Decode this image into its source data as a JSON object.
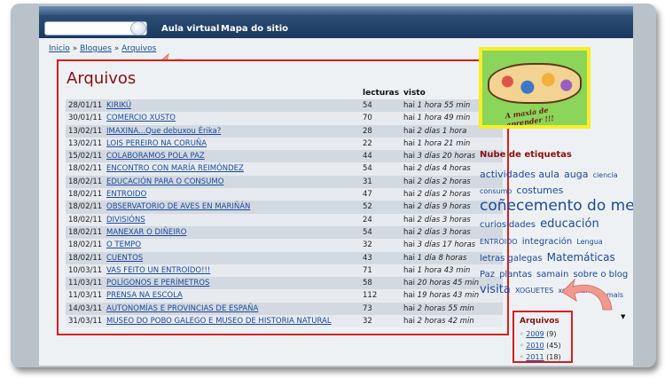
{
  "header": {
    "search": {
      "value": "",
      "placeholder": ""
    },
    "nav": [
      "Aula virtual",
      "Mapa do sitio"
    ]
  },
  "breadcrumb": [
    "Inicio",
    "Blogues",
    "Arquivos"
  ],
  "main": {
    "title": "Arquivos",
    "columns": {
      "reads": "lecturas",
      "seen": "visto"
    },
    "rows": [
      {
        "date": "28/01/11",
        "title": "KIRIKÚ",
        "reads": "54",
        "seen_prefix": "hai",
        "seen": "1 hora 55 min"
      },
      {
        "date": "30/01/11",
        "title": "COMERCIO XUSTO",
        "reads": "70",
        "seen_prefix": "hai",
        "seen": "1 hora 49 min"
      },
      {
        "date": "13/02/11",
        "title": "IMAXINA...Que debuxou Érika?",
        "reads": "28",
        "seen_prefix": "hai",
        "seen": "2 días 1 hora"
      },
      {
        "date": "13/02/11",
        "title": "LOIS PEREIRO NA CORUÑA",
        "reads": "22",
        "seen_prefix": "hai",
        "seen": "1 hora 21 min"
      },
      {
        "date": "15/02/11",
        "title": "COLABORAMOS POLA PAZ",
        "reads": "44",
        "seen_prefix": "hai",
        "seen": "3 días 20 horas"
      },
      {
        "date": "18/02/11",
        "title": "ENCONTRO CON MARÍA REIMÓNDEZ",
        "reads": "54",
        "seen_prefix": "hai",
        "seen": "2 días 4 horas"
      },
      {
        "date": "18/02/11",
        "title": "EDUCACIÓN PARA O CONSUMO",
        "reads": "31",
        "seen_prefix": "hai",
        "seen": "2 días 2 horas"
      },
      {
        "date": "18/02/11",
        "title": "ENTROIDO",
        "reads": "47",
        "seen_prefix": "hai",
        "seen": "2 días 2 horas"
      },
      {
        "date": "18/02/11",
        "title": "OBSERVATORIO DE AVES EN MARIÑÁN",
        "reads": "52",
        "seen_prefix": "hai",
        "seen": "2 días 9 horas"
      },
      {
        "date": "18/02/11",
        "title": "DIVISIÓNS",
        "reads": "24",
        "seen_prefix": "hai",
        "seen": "2 días 3 horas"
      },
      {
        "date": "18/02/11",
        "title": "MANEXAR O DIÑEIRO",
        "reads": "54",
        "seen_prefix": "hai",
        "seen": "2 días 3 horas"
      },
      {
        "date": "18/02/11",
        "title": "O TEMPO",
        "reads": "32",
        "seen_prefix": "hai",
        "seen": "3 días 17 horas"
      },
      {
        "date": "18/02/11",
        "title": "CUENTOS",
        "reads": "43",
        "seen_prefix": "hai",
        "seen": "1 día 8 horas"
      },
      {
        "date": "10/03/11",
        "title": "VAS FEITO UN ENTROIDO!!!",
        "reads": "71",
        "seen_prefix": "hai",
        "seen": "1 hora 43 min"
      },
      {
        "date": "11/03/11",
        "title": "POLÍGONOS E PERÍMETROS",
        "reads": "58",
        "seen_prefix": "hai",
        "seen": "20 horas 45 min"
      },
      {
        "date": "11/03/11",
        "title": "PRENSA NA ESCOLA",
        "reads": "112",
        "seen_prefix": "hai",
        "seen": "19 horas 43 min"
      },
      {
        "date": "14/03/11",
        "title": "AUTONOMÍAS E PROVINCIAS DE ESPAÑA",
        "reads": "73",
        "seen_prefix": "hai",
        "seen": "2 horas 55 min"
      },
      {
        "date": "31/03/11",
        "title": "MUSEO DO POBO GALEGO E MUSEO DE HISTORIA NATURAL",
        "reads": "32",
        "seen_prefix": "hai",
        "seen": "2 horas 42 min"
      }
    ]
  },
  "sidebar": {
    "banner_caption": "A maxia de aprender !!!",
    "tags_title": "Nube de etiquetas",
    "tags": [
      {
        "label": "actividades aula",
        "size": 11
      },
      {
        "label": "auga",
        "size": 11
      },
      {
        "label": "ciencia",
        "size": 8
      },
      {
        "label": "consumo",
        "size": 8
      },
      {
        "label": "costumes",
        "size": 11
      },
      {
        "label": "coñecemento do medio",
        "size": 17
      },
      {
        "label": "curiosidades",
        "size": 10
      },
      {
        "label": "educación",
        "size": 13
      },
      {
        "label": "ENTROIDO",
        "size": 8
      },
      {
        "label": "integración",
        "size": 10
      },
      {
        "label": "Lengua",
        "size": 8
      },
      {
        "label": "letras galegas",
        "size": 10
      },
      {
        "label": "Matemáticas",
        "size": 12
      },
      {
        "label": "Paz",
        "size": 10
      },
      {
        "label": "plantas",
        "size": 10
      },
      {
        "label": "samain",
        "size": 10
      },
      {
        "label": "sobre o blog",
        "size": 10
      },
      {
        "label": "visita",
        "size": 13
      },
      {
        "label": "XOGUETES",
        "size": 8
      },
      {
        "label": "xornalismo",
        "size": 8
      }
    ],
    "more": "mais",
    "archive": {
      "title": "Arquivos",
      "items": [
        {
          "year": "2009",
          "count": "(9)"
        },
        {
          "year": "2010",
          "count": "(45)"
        },
        {
          "year": "2011",
          "count": "(18)"
        }
      ]
    }
  },
  "colors": {
    "accent_red": "#d81e1e",
    "title_red": "#8c0e0e",
    "link": "#1a4aa0",
    "header_blue": "#1a3961",
    "arrow": "#e8877e"
  }
}
